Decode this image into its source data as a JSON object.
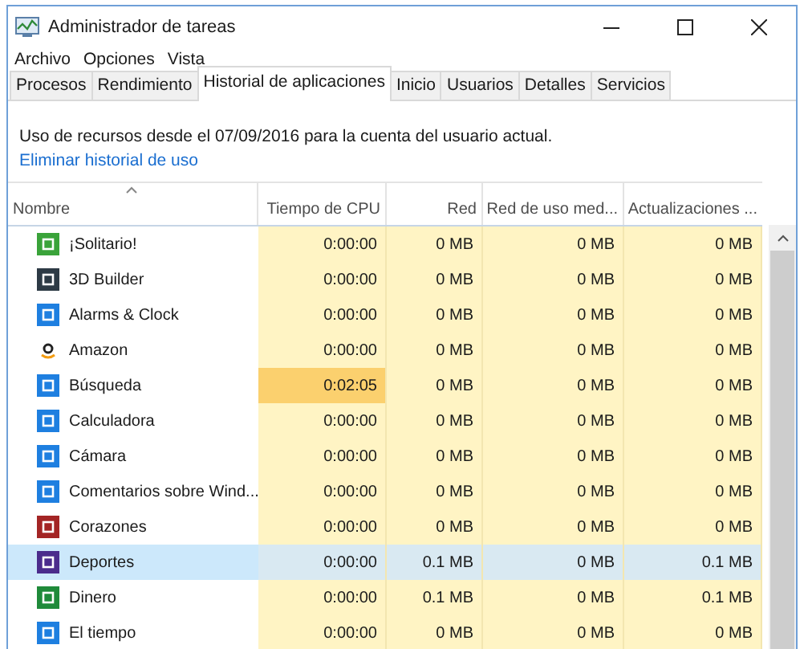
{
  "window": {
    "title": "Administrador de tareas"
  },
  "menu": [
    "Archivo",
    "Opciones",
    "Vista"
  ],
  "tabs": [
    {
      "label": "Procesos",
      "selected": false
    },
    {
      "label": "Rendimiento",
      "selected": false
    },
    {
      "label": "Historial de aplicaciones",
      "selected": true
    },
    {
      "label": "Inicio",
      "selected": false
    },
    {
      "label": "Usuarios",
      "selected": false
    },
    {
      "label": "Detalles",
      "selected": false
    },
    {
      "label": "Servicios",
      "selected": false
    }
  ],
  "info": {
    "text": "Uso de recursos desde el 07/09/2016 para la cuenta del usuario actual.",
    "link": "Eliminar historial de uso"
  },
  "table": {
    "columns": [
      "Nombre",
      "Tiempo de CPU",
      "Red",
      "Red de uso med...",
      "Actualizaciones ..."
    ],
    "rows": [
      {
        "name": "¡Solitario!",
        "color": "#3aa33a",
        "cpu": "0:00:00",
        "net": "0 MB",
        "metered": "0 MB",
        "updates": "0 MB",
        "cpu_high": false,
        "selected": false
      },
      {
        "name": "3D Builder",
        "color": "#2d3a45",
        "cpu": "0:00:00",
        "net": "0 MB",
        "metered": "0 MB",
        "updates": "0 MB",
        "cpu_high": false,
        "selected": false
      },
      {
        "name": "Alarms & Clock",
        "color": "#1e7fe0",
        "cpu": "0:00:00",
        "net": "0 MB",
        "metered": "0 MB",
        "updates": "0 MB",
        "cpu_high": false,
        "selected": false
      },
      {
        "name": "Amazon",
        "kind": "glyph",
        "cpu": "0:00:00",
        "net": "0 MB",
        "metered": "0 MB",
        "updates": "0 MB",
        "cpu_high": false,
        "selected": false
      },
      {
        "name": "Búsqueda",
        "color": "#1e7fe0",
        "cpu": "0:02:05",
        "net": "0 MB",
        "metered": "0 MB",
        "updates": "0 MB",
        "cpu_high": true,
        "selected": false
      },
      {
        "name": "Calculadora",
        "color": "#1e7fe0",
        "cpu": "0:00:00",
        "net": "0 MB",
        "metered": "0 MB",
        "updates": "0 MB",
        "cpu_high": false,
        "selected": false
      },
      {
        "name": "Cámara",
        "color": "#1e7fe0",
        "cpu": "0:00:00",
        "net": "0 MB",
        "metered": "0 MB",
        "updates": "0 MB",
        "cpu_high": false,
        "selected": false
      },
      {
        "name": "Comentarios sobre Wind...",
        "color": "#1e7fe0",
        "cpu": "0:00:00",
        "net": "0 MB",
        "metered": "0 MB",
        "updates": "0 MB",
        "cpu_high": false,
        "selected": false
      },
      {
        "name": "Corazones",
        "color": "#a32525",
        "cpu": "0:00:00",
        "net": "0 MB",
        "metered": "0 MB",
        "updates": "0 MB",
        "cpu_high": false,
        "selected": false
      },
      {
        "name": "Deportes",
        "color": "#4b2c8c",
        "cpu": "0:00:00",
        "net": "0.1 MB",
        "metered": "0 MB",
        "updates": "0.1 MB",
        "cpu_high": false,
        "selected": true
      },
      {
        "name": "Dinero",
        "color": "#1f8a3a",
        "cpu": "0:00:00",
        "net": "0.1 MB",
        "metered": "0 MB",
        "updates": "0.1 MB",
        "cpu_high": false,
        "selected": false
      },
      {
        "name": "El tiempo",
        "color": "#1e7fe0",
        "cpu": "0:00:00",
        "net": "0 MB",
        "metered": "0 MB",
        "updates": "0 MB",
        "cpu_high": false,
        "selected": false
      }
    ]
  }
}
